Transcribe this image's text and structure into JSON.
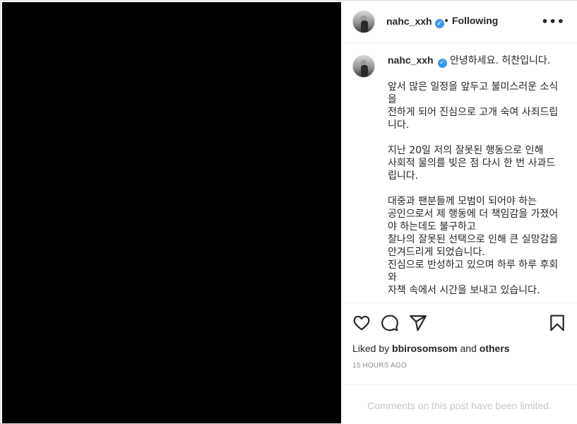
{
  "post": {
    "username": "nahc_xxh",
    "following_label": "Following",
    "separator": "•",
    "more_label": "•••",
    "verified_mark": "✓"
  },
  "caption": {
    "username": "nahc_xxh",
    "text": "안녕하세요. 허찬입니다.\n\n앞서 많은 일정을 앞두고 불미스러운 소식을\n전하게 되어 진심으로 고개 숙여 사죄드립니다.\n\n지난 20일 저의 잘못된 행동으로 인해\n사회적 물의를 빚은 점 다시 한 번 사과드립니다.\n\n대중과 팬분들께 모범이 되어야 하는\n공인으로서 제 행동에 더 책임감을 가졌어야 하는데도 불구하고\n찰나의 잘못된 선택으로 인해 큰 실망감을\n안겨드리게 되었습니다.\n진심으로 반성하고 있으며 하루 하루 후회와\n자책 속에서 시간을 보내고 있습니다."
  },
  "engagement": {
    "liked_prefix": "Liked by ",
    "liked_user": "bbirosomsom",
    "liked_conj": " and ",
    "liked_others": "others",
    "timestamp": "15 HOURS AGO"
  },
  "comments": {
    "limited_notice": "Comments on this post have been limited."
  },
  "icons": {
    "like": "heart-icon",
    "comment": "comment-icon",
    "share": "share-icon",
    "save": "bookmark-icon",
    "more": "more-options-icon"
  },
  "colors": {
    "verified": "#3897f0",
    "muted_text": "#8e8e8e",
    "limited_text": "#c7c7c7"
  }
}
